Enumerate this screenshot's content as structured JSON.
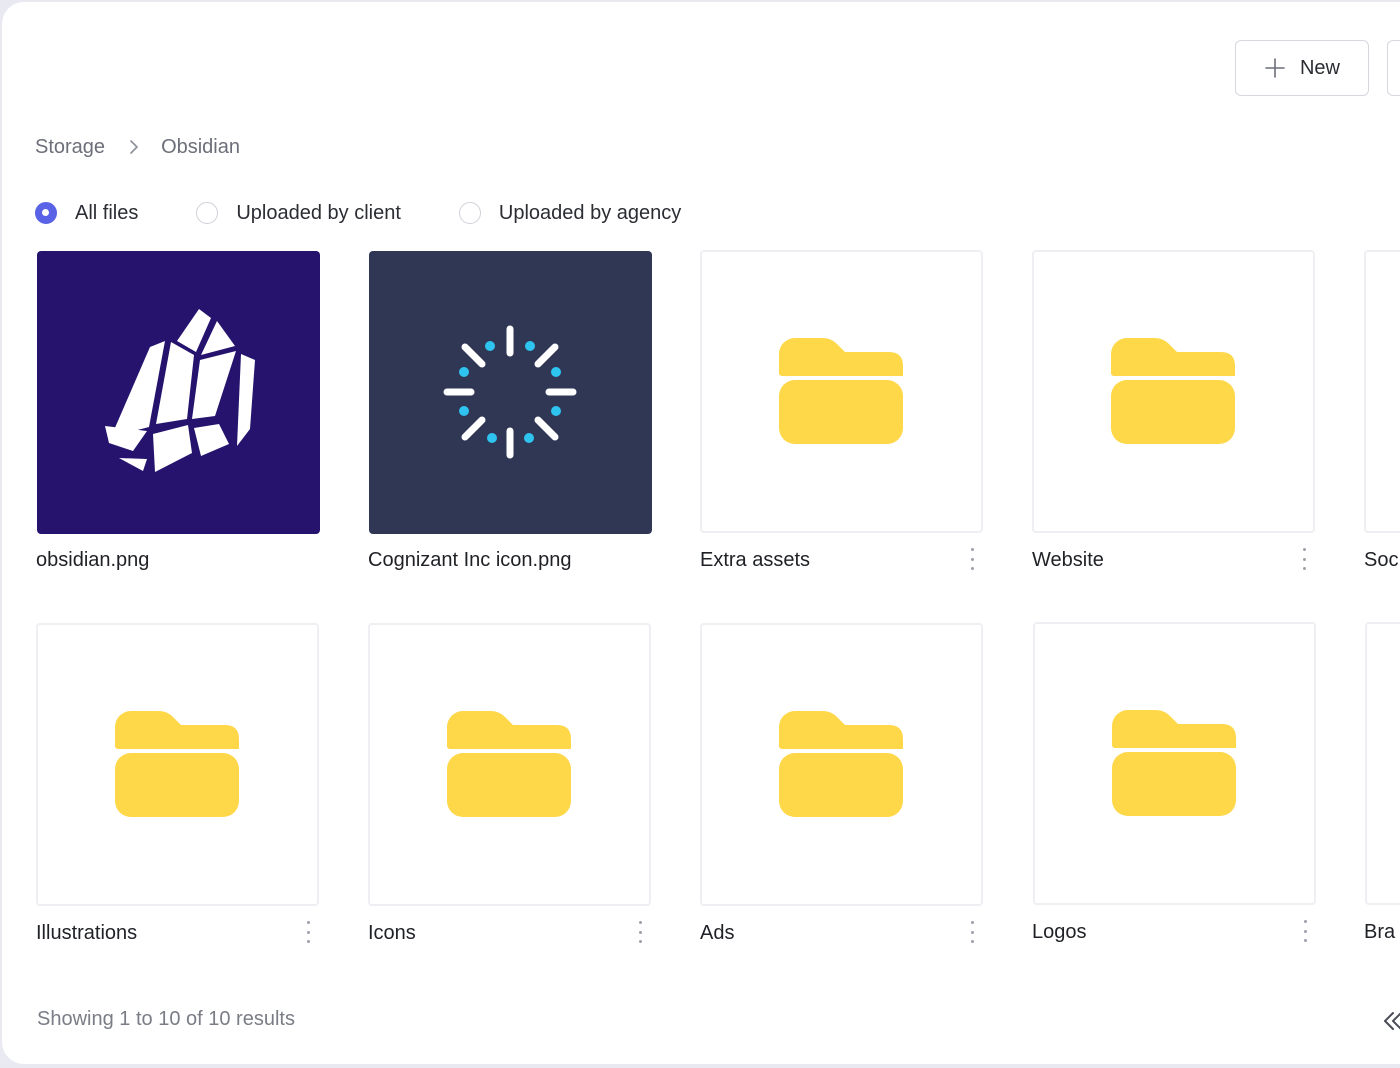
{
  "toolbar": {
    "new_label": "New",
    "new_icon": "plus-icon"
  },
  "breadcrumb": {
    "items": [
      "Storage",
      "Obsidian"
    ]
  },
  "filters": [
    {
      "label": "All files",
      "selected": true
    },
    {
      "label": "Uploaded by client",
      "selected": false
    },
    {
      "label": "Uploaded by agency",
      "selected": false
    }
  ],
  "files": [
    {
      "name": "obsidian.png",
      "kind": "image",
      "thumb": "obsidian-logo-icon"
    },
    {
      "name": "Cognizant Inc icon.png",
      "kind": "image",
      "thumb": "loading-spinner-icon"
    },
    {
      "name": "Extra assets",
      "kind": "folder"
    },
    {
      "name": "Website",
      "kind": "folder"
    },
    {
      "name": "Soc",
      "kind": "folder"
    },
    {
      "name": "Illustrations",
      "kind": "folder"
    },
    {
      "name": "Icons",
      "kind": "folder"
    },
    {
      "name": "Ads",
      "kind": "folder"
    },
    {
      "name": "Logos",
      "kind": "folder"
    },
    {
      "name": "Bra",
      "kind": "folder"
    }
  ],
  "footer": {
    "results_text": "Showing 1 to 10 of 10 results"
  },
  "colors": {
    "accent": "#5a63e6",
    "folder": "#ffd84a",
    "obsidian_bg": "#25136e",
    "cognizant_bg": "#2f3755",
    "spinner_dots": "#2fc4f0"
  }
}
